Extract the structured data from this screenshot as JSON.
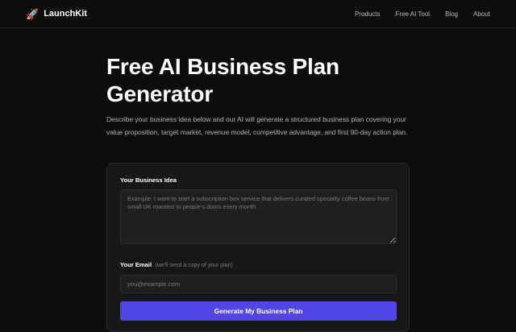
{
  "nav": {
    "brand_icon": "🚀",
    "brand_name": "LaunchKit",
    "links": [
      {
        "label": "Products"
      },
      {
        "label": "Free AI Tool"
      },
      {
        "label": "Blog"
      },
      {
        "label": "About"
      }
    ]
  },
  "hero": {
    "title": "Free AI Business Plan Generator",
    "description": "Describe your business idea below and our AI will generate a structured business plan covering your value proposition, target market, revenue model, competitive advantage, and first 90-day action plan."
  },
  "form": {
    "idea_label": "Your Business Idea",
    "idea_placeholder": "Example: I want to start a subscription box service that delivers curated specialty coffee beans from small UK roasters to people's doors every month.",
    "email_label": "Your Email",
    "email_hint": "(we'll send a copy of your plan)",
    "email_placeholder": "you@example.com",
    "submit_label": "Generate My Business Plan"
  },
  "colors": {
    "background": "#0d0d0d",
    "card": "#171717",
    "accent": "#4f46e5"
  }
}
